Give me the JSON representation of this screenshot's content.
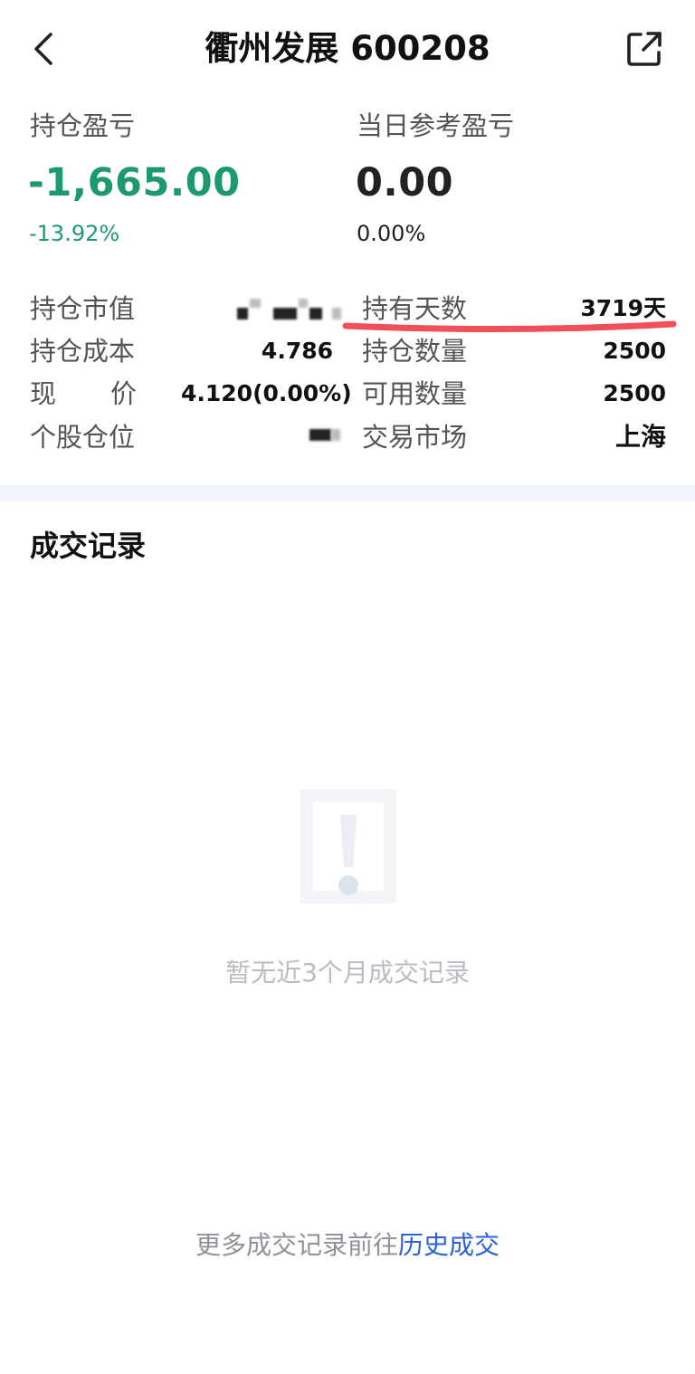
{
  "header": {
    "title": "衢州发展 600208"
  },
  "summary": {
    "holding_pl_label": "持仓盈亏",
    "holding_pl_value": "-1,665.00",
    "holding_pl_pct": "-13.92%",
    "daily_pl_label": "当日参考盈亏",
    "daily_pl_value": "0.00",
    "daily_pl_pct": "0.00%"
  },
  "details": {
    "market_value_label": "持仓市值",
    "cost_label": "持仓成本",
    "cost_value": "4.786",
    "price_label_left": "现",
    "price_label_right": "价",
    "price_value": "4.120(0.00%)",
    "position_ratio_label": "个股仓位",
    "hold_days_label": "持有天数",
    "hold_days_value": "3719天",
    "hold_qty_label": "持仓数量",
    "hold_qty_value": "2500",
    "avail_qty_label": "可用数量",
    "avail_qty_value": "2500",
    "market_label": "交易市场",
    "market_value": "上海"
  },
  "records": {
    "section_title": "成交记录",
    "empty_text": "暂无近3个月成交记录",
    "footer_prefix": "更多成交记录前往",
    "footer_link": "历史成交"
  },
  "colors": {
    "loss_green": "#1d9a6c",
    "link_blue": "#2b62d9",
    "underline_red": "#f0505a"
  },
  "icons": {
    "back": "chevron-left-icon",
    "share": "share-external-icon",
    "empty": "warning-document-icon"
  }
}
